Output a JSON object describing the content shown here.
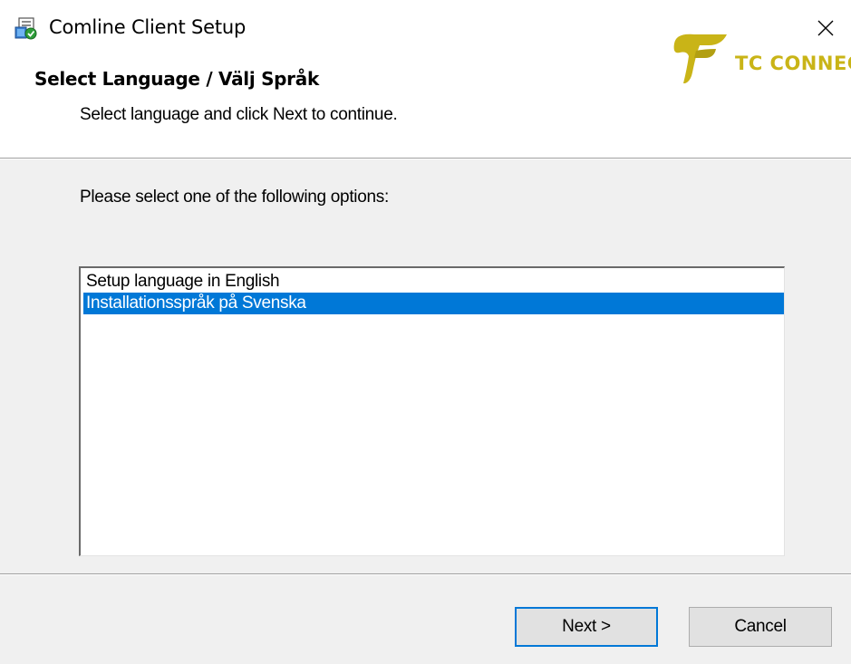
{
  "window": {
    "title": "Comline Client Setup"
  },
  "header": {
    "title": "Select Language / Välj Språk",
    "subtitle": "Select language and click Next to continue.",
    "logo_text": "TC CONNECT",
    "logo_color": "#c9b417"
  },
  "main": {
    "prompt": "Please select one of the following options:",
    "options": [
      {
        "label": "Setup language in English",
        "selected": false
      },
      {
        "label": "Installationsspråk på Svenska",
        "selected": true
      }
    ]
  },
  "buttons": {
    "next_label": "Next >",
    "cancel_label": "Cancel"
  },
  "colors": {
    "selection": "#0078d7",
    "dialog_bg": "#f0f0f0",
    "accent": "#0078d7"
  },
  "icons": {
    "app": "installer-icon",
    "close": "close-icon"
  }
}
